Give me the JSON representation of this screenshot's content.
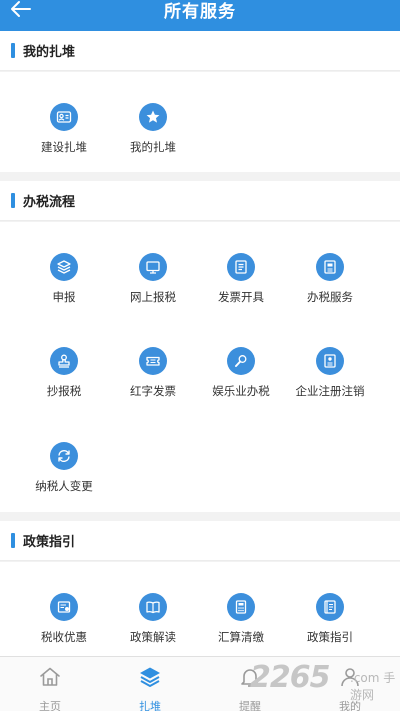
{
  "header": {
    "title": "所有服务"
  },
  "sections": [
    {
      "title": "我的扎堆",
      "items": [
        {
          "label": "建设扎堆",
          "icon": "contact-card-icon"
        },
        {
          "label": "我的扎堆",
          "icon": "star-icon"
        }
      ]
    },
    {
      "title": "办税流程",
      "items": [
        {
          "label": "申报",
          "icon": "layers-icon"
        },
        {
          "label": "网上报税",
          "icon": "monitor-icon"
        },
        {
          "label": "发票开具",
          "icon": "document-icon"
        },
        {
          "label": "办税服务",
          "icon": "folder-doc-icon"
        },
        {
          "label": "抄报税",
          "icon": "stamp-icon"
        },
        {
          "label": "红字发票",
          "icon": "ticket-icon"
        },
        {
          "label": "娱乐业办税",
          "icon": "microphone-icon"
        },
        {
          "label": "企业注册注销",
          "icon": "id-card-icon"
        },
        {
          "label": "纳税人变更",
          "icon": "refresh-icon"
        }
      ]
    },
    {
      "title": "政策指引",
      "items": [
        {
          "label": "税收优惠",
          "icon": "receipt-icon"
        },
        {
          "label": "政策解读",
          "icon": "book-icon"
        },
        {
          "label": "汇算清缴",
          "icon": "calculator-icon"
        },
        {
          "label": "政策指引",
          "icon": "guide-book-icon"
        }
      ]
    }
  ],
  "tabbar": [
    {
      "label": "主页",
      "icon": "home-icon",
      "active": false
    },
    {
      "label": "扎堆",
      "icon": "layers-icon",
      "active": true
    },
    {
      "label": "提醒",
      "icon": "bell-icon",
      "active": false
    },
    {
      "label": "我的",
      "icon": "person-icon",
      "active": false
    }
  ],
  "watermark": {
    "number": "2265",
    "suffix": ".com",
    "brand": "手游网"
  },
  "colors": {
    "accent": "#2f8fe0",
    "icon_bg": "#3c8fdc",
    "background": "#f2f2f2"
  }
}
